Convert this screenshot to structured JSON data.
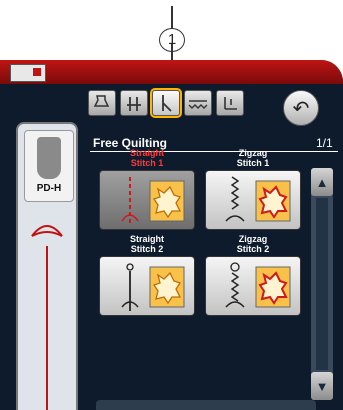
{
  "callout": {
    "number": "1"
  },
  "toolbar": {
    "buttons": [
      {
        "name": "foot-pressure-icon",
        "selected": false
      },
      {
        "name": "feed-dog-icon",
        "selected": false
      },
      {
        "name": "needle-position-icon",
        "selected": true
      },
      {
        "name": "stitch-pattern-icon",
        "selected": false
      },
      {
        "name": "thread-tension-icon",
        "selected": false
      }
    ],
    "back_icon": "undo-arrow-icon"
  },
  "left_panel": {
    "foot_label": "PD-H"
  },
  "main": {
    "title": "Free Quilting",
    "page": "1/1",
    "stitches": [
      {
        "line1": "Straight",
        "line2": "Stitch 1",
        "selected": true
      },
      {
        "line1": "Zigzag",
        "line2": "Stitch 1",
        "selected": false
      },
      {
        "line1": "Straight",
        "line2": "Stitch 2",
        "selected": false
      },
      {
        "line1": "Zigzag",
        "line2": "Stitch 2",
        "selected": false
      }
    ]
  },
  "colors": {
    "screen_bg": "#0d1b2c",
    "topbar_red": "#c01414",
    "selected_label": "#ff3b3b",
    "highlight": "#ffb400"
  }
}
